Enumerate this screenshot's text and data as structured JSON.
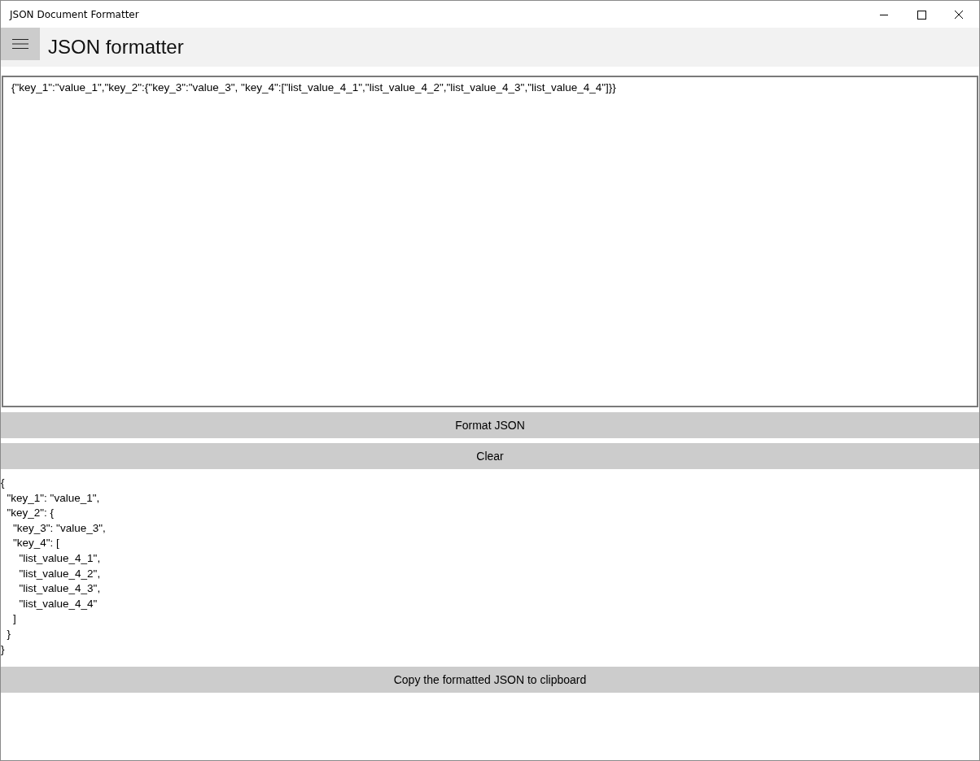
{
  "window": {
    "title": "JSON Document Formatter"
  },
  "header": {
    "title": "JSON formatter"
  },
  "input": {
    "value": "{\"key_1\":\"value_1\",\"key_2\":{\"key_3\":\"value_3\", \"key_4\":[\"list_value_4_1\",\"list_value_4_2\",\"list_value_4_3\",\"list_value_4_4\"]}}"
  },
  "buttons": [
    "Format JSON",
    "Clear"
  ],
  "output": "{\n  \"key_1\": \"value_1\",\n  \"key_2\": {\n    \"key_3\": \"value_3\",\n    \"key_4\": [\n      \"list_value_4_1\",\n      \"list_value_4_2\",\n      \"list_value_4_3\",\n      \"list_value_4_4\"\n    ]\n  }\n}",
  "copy_button": "Copy the formatted JSON to clipboard"
}
